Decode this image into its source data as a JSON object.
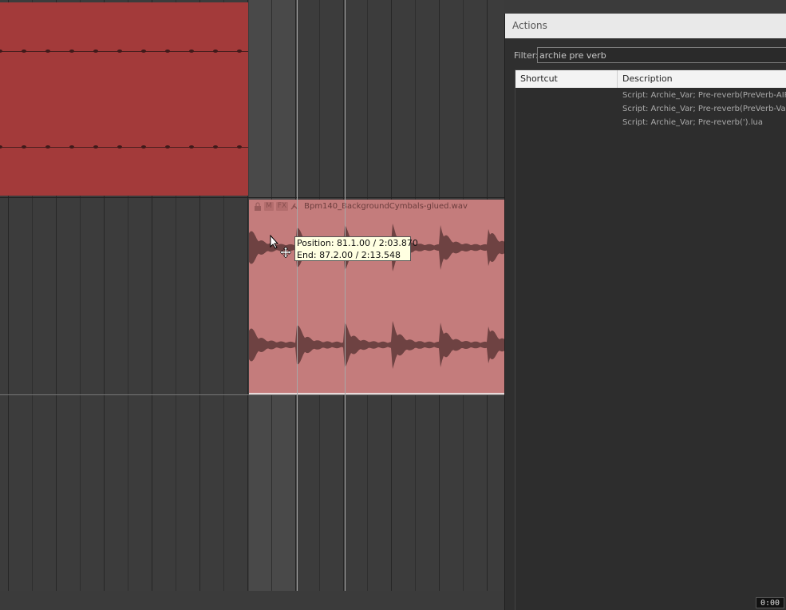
{
  "arrange": {
    "item": {
      "buttons": [
        "M",
        "FX"
      ],
      "name": "Bpm140_BackgroundCymbals-glued.wav"
    },
    "tooltip": {
      "position": "Position: 81.1.00 / 2:03.870",
      "end": "End: 87.2.00 / 2:13.548"
    }
  },
  "actions_window": {
    "title": "Actions",
    "filter_label": "Filter:",
    "filter_value": "archie pre verb",
    "columns": {
      "shortcut": "Shortcut",
      "description": "Description"
    },
    "rows": [
      {
        "shortcut": "",
        "description": "Script: Archie_Var;  Pre-reverb(PreVerb-AIR)"
      },
      {
        "shortcut": "",
        "description": "Script: Archie_Var;  Pre-reverb(PreVerb-Valh"
      },
      {
        "shortcut": "",
        "description": "Script: Archie_Var;  Pre-reverb(').lua"
      }
    ]
  },
  "timer": "0:00",
  "colors": {
    "red_item": "#a33a3a",
    "audio_item": "#c47c7c",
    "tooltip_bg": "#ffffe1"
  },
  "icons": [
    "lock-icon",
    "glue-icon",
    "mouse-pointer-icon",
    "move-cursor-icon"
  ]
}
